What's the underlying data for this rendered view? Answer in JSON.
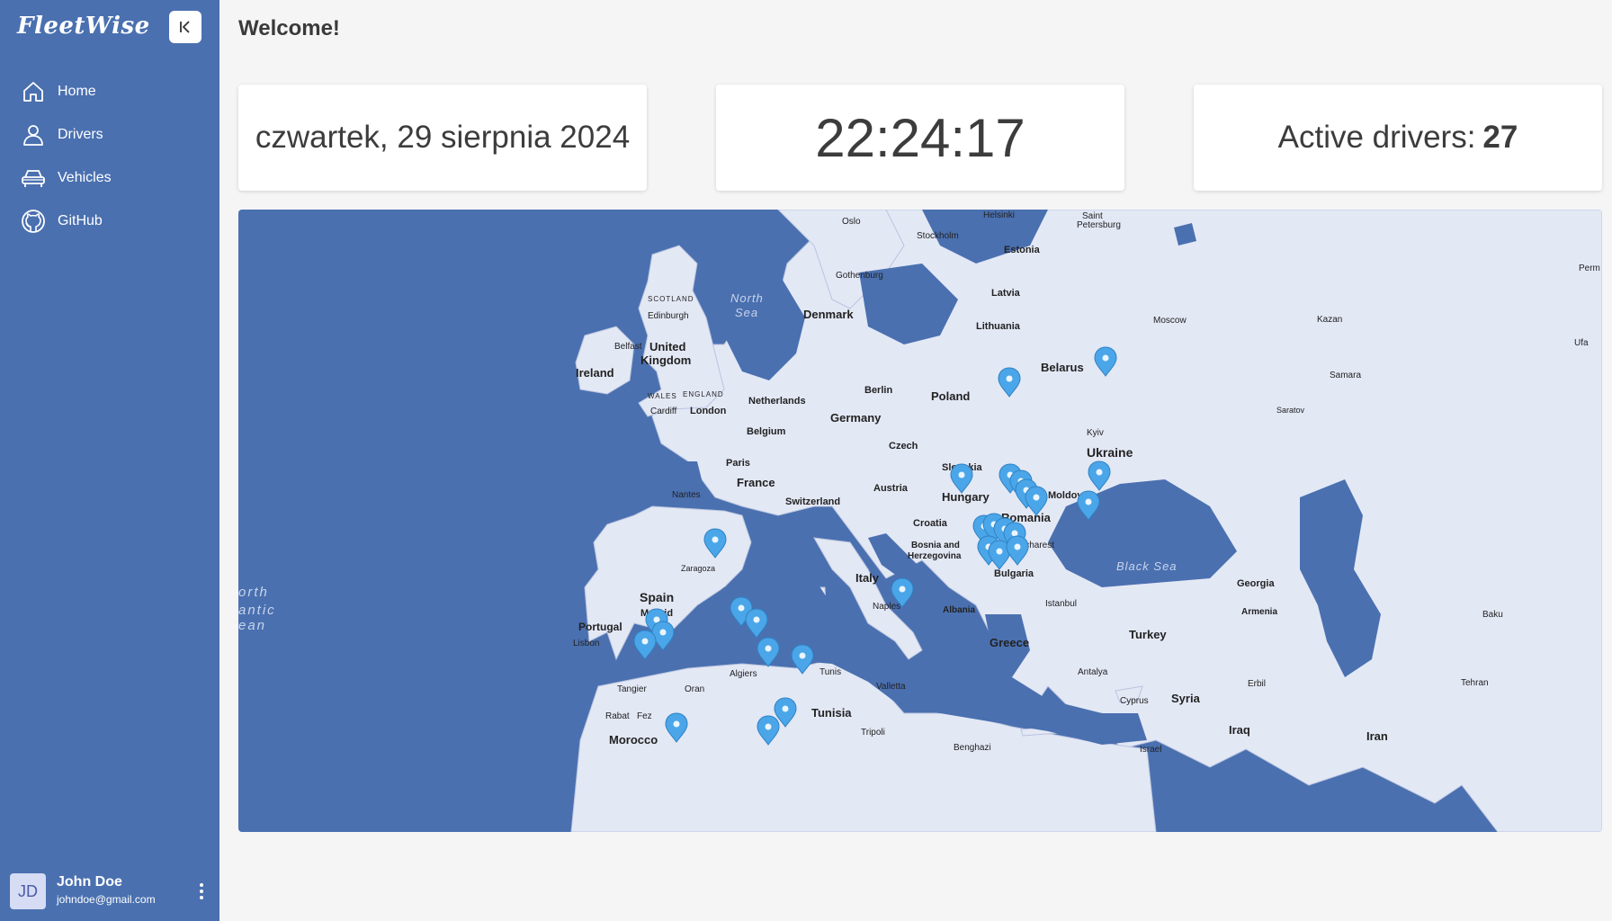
{
  "app": {
    "brand": "FleetWise"
  },
  "sidebar": {
    "items": [
      {
        "label": "Home",
        "icon": "home-icon"
      },
      {
        "label": "Drivers",
        "icon": "user-icon"
      },
      {
        "label": "Vehicles",
        "icon": "car-icon"
      },
      {
        "label": "GitHub",
        "icon": "github-icon"
      }
    ],
    "collapse_icon": "collapse-left-icon"
  },
  "user": {
    "initials": "JD",
    "name": "John Doe",
    "email": "johndoe@gmail.com"
  },
  "header": {
    "title": "Welcome!"
  },
  "cards": {
    "date": "czwartek, 29 sierpnia 2024",
    "time": "22:24:17",
    "active_label": "Active drivers:",
    "active_count": "27"
  },
  "map": {
    "labels": {
      "countries": [
        "Ireland",
        "United",
        "Kingdom",
        "Denmark",
        "Netherlands",
        "Belgium",
        "Germany",
        "Poland",
        "France",
        "Czech",
        "Slovakia",
        "Austria",
        "Hungary",
        "Switzerland",
        "Croatia",
        "Bosnia and",
        "Herzegovina",
        "Romania",
        "Moldova",
        "Ukraine",
        "Belarus",
        "Latvia",
        "Estonia",
        "Lithuania",
        "Bulgaria",
        "Italy",
        "Spain",
        "Portugal",
        "Albania",
        "Greece",
        "Turkey",
        "Georgia",
        "Armenia",
        "Syria",
        "Iraq",
        "Iran",
        "Tunisia",
        "Morocco"
      ],
      "cities": [
        "Oslo",
        "Stockholm",
        "Helsinki",
        "Saint",
        "Petersburg",
        "Gothenburg",
        "Edinburgh",
        "Belfast",
        "Cardiff",
        "London",
        "Paris",
        "Nantes",
        "Berlin",
        "Moscow",
        "Kazan",
        "Perm",
        "Ufa",
        "Samara",
        "Saratov",
        "Kyiv",
        "Bucharest",
        "Istanbul",
        "Naples",
        "Madrid",
        "Lisbon",
        "Zaragoza",
        "Tangier",
        "Rabat",
        "Fez",
        "Oran",
        "Algiers",
        "Tunis",
        "Valletta",
        "Tripoli",
        "Benghazi",
        "Antalya",
        "Cyprus",
        "Israel",
        "Baku",
        "Tehran",
        "Erbil"
      ],
      "regions": [
        "SCOTLAND",
        "WALES",
        "ENGLAND"
      ],
      "seas": [
        "North",
        "Sea",
        "Black Sea",
        "orth",
        "antic",
        "ean"
      ]
    },
    "marker_color": "#4aa6e8",
    "land_color": "#e3e8f5",
    "water_color": "#4a70b0"
  }
}
